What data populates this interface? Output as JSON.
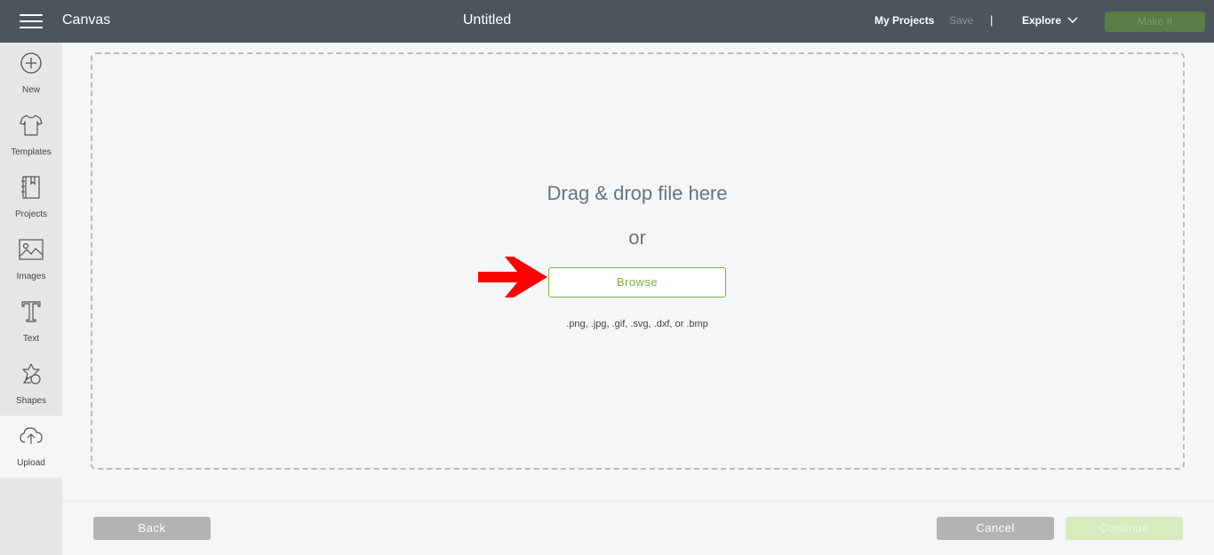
{
  "header": {
    "app_title": "Canvas",
    "doc_title": "Untitled",
    "my_projects": "My Projects",
    "save": "Save",
    "divider": "|",
    "explore": "Explore",
    "make_it": "Make It"
  },
  "sidebar": {
    "items": [
      {
        "label": "New",
        "icon": "plus-circle-icon"
      },
      {
        "label": "Templates",
        "icon": "tshirt-icon"
      },
      {
        "label": "Projects",
        "icon": "notebook-icon"
      },
      {
        "label": "Images",
        "icon": "image-icon"
      },
      {
        "label": "Text",
        "icon": "text-t-icon"
      },
      {
        "label": "Shapes",
        "icon": "shapes-icon"
      },
      {
        "label": "Upload",
        "icon": "cloud-upload-icon",
        "active": true
      }
    ]
  },
  "upload": {
    "drag_text": "Drag & drop file here",
    "or_text": "or",
    "browse": "Browse",
    "formats": ".png, .jpg, .gif, .svg, .dxf, or .bmp"
  },
  "footer": {
    "back": "Back",
    "cancel": "Cancel",
    "continue": "Continue"
  },
  "colors": {
    "topbar": "#4c555d",
    "accent_green": "#78b044",
    "arrow_red": "#ff0000"
  }
}
